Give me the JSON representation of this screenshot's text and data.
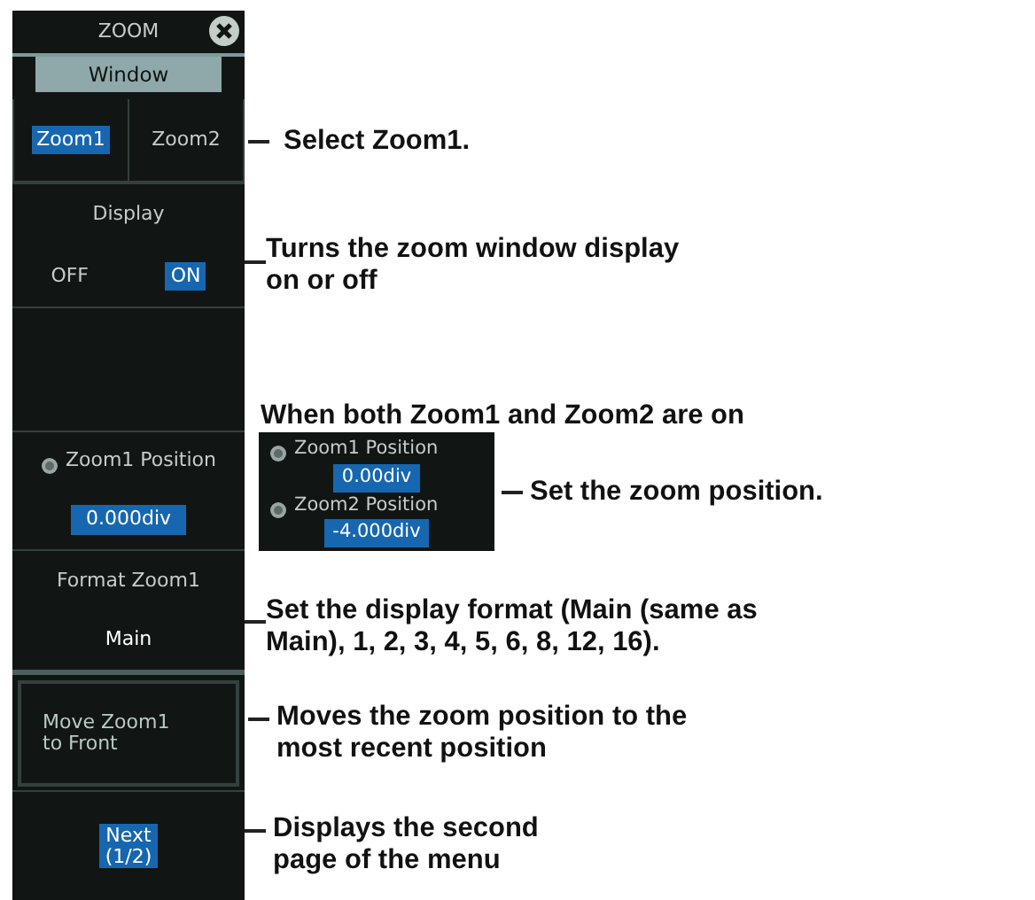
{
  "panel": {
    "title": "ZOOM",
    "window_tab": "Window",
    "zoom_tabs": [
      {
        "label": "Zoom1",
        "selected": true
      },
      {
        "label": "Zoom2",
        "selected": false
      }
    ],
    "display": {
      "label": "Display",
      "options": [
        {
          "label": "OFF",
          "selected": false
        },
        {
          "label": "ON",
          "selected": true
        }
      ]
    },
    "position": {
      "label": "Zoom1 Position",
      "value": "0.000div"
    },
    "format": {
      "label": "Format Zoom1",
      "value": "Main"
    },
    "move_button": "Move Zoom1\nto Front",
    "next_button": "Next\n(1/2)"
  },
  "inset": {
    "rows": [
      {
        "label": "Zoom1 Position",
        "value": "0.00div"
      },
      {
        "label": "Zoom2 Position",
        "value": "-4.000div"
      }
    ]
  },
  "annotations": {
    "select": "Select Zoom1.",
    "display": "Turns the zoom window display\non or off",
    "both_on": "When both Zoom1 and Zoom2 are on",
    "position": "Set the zoom position.",
    "format": "Set the display format (Main (same as\nMain), 1, 2, 3, 4, 5, 6, 8, 12, 16).",
    "move": "Moves the zoom position to the\nmost recent position",
    "next": "Displays the second\npage of the menu"
  }
}
